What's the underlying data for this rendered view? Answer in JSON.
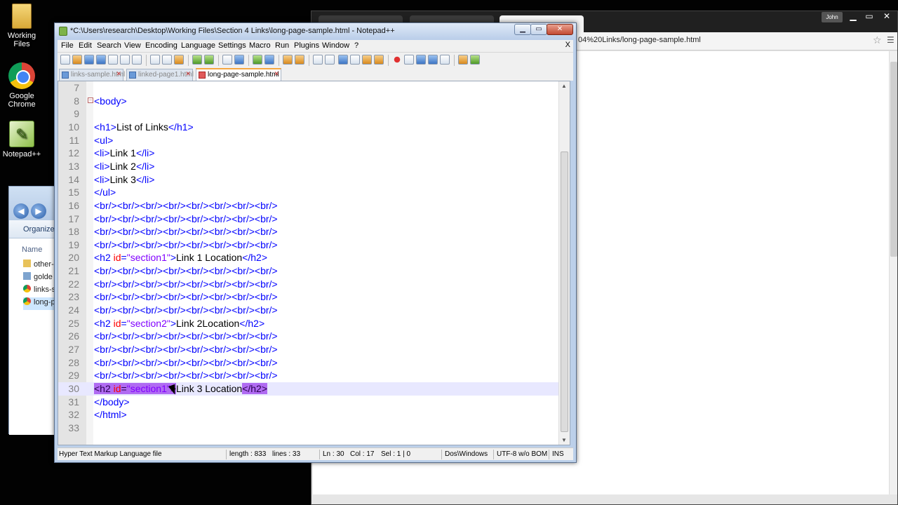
{
  "desktop": {
    "icons": [
      {
        "label": "Working Files",
        "icon": "folder-icon"
      },
      {
        "label": "Google Chrome",
        "icon": "chrome-icon"
      },
      {
        "label": "Notepad++",
        "icon": "notepadpp-icon"
      }
    ]
  },
  "browser": {
    "user": "John",
    "url": "04%20Links/long-page-sample.html",
    "close_label": "×"
  },
  "explorer": {
    "organize": "Organize",
    "column_name": "Name",
    "files": [
      "other-",
      "golde",
      "links-s",
      "long-p"
    ]
  },
  "npp": {
    "title": "*C:\\Users\\research\\Desktop\\Working Files\\Section 4 Links\\long-page-sample.html - Notepad++",
    "window_buttons": {
      "minimize": "▁",
      "maximize": "▭",
      "close": "✕"
    },
    "menu": [
      "File",
      "Edit",
      "Search",
      "View",
      "Encoding",
      "Language",
      "Settings",
      "Macro",
      "Run",
      "Plugins",
      "Window",
      "?"
    ],
    "menu_close": "X",
    "tabs": [
      {
        "label": "links-sample.html"
      },
      {
        "label": "linked-page1.html"
      },
      {
        "label": "long-page-sample.html"
      }
    ],
    "active_tab": 2,
    "current_line": 30,
    "lines": [
      {
        "n": "7",
        "code": ""
      },
      {
        "n": "8",
        "code": "<body>"
      },
      {
        "n": "9",
        "code": ""
      },
      {
        "n": "10",
        "code": "<h1>List of Links</h1>"
      },
      {
        "n": "11",
        "code": "<ul>"
      },
      {
        "n": "12",
        "code": "<li>Link 1</li>"
      },
      {
        "n": "13",
        "code": "<li>Link 2</li>"
      },
      {
        "n": "14",
        "code": "<li>Link 3</li>"
      },
      {
        "n": "15",
        "code": "</ul>"
      },
      {
        "n": "16",
        "code": "<br/><br/><br/><br/><br/><br/><br/><br/>"
      },
      {
        "n": "17",
        "code": "<br/><br/><br/><br/><br/><br/><br/><br/>"
      },
      {
        "n": "18",
        "code": "<br/><br/><br/><br/><br/><br/><br/><br/>"
      },
      {
        "n": "19",
        "code": "<br/><br/><br/><br/><br/><br/><br/><br/>"
      },
      {
        "n": "20",
        "code": "<h2 id=\"section1\">Link 1 Location</h2>"
      },
      {
        "n": "21",
        "code": "<br/><br/><br/><br/><br/><br/><br/><br/>"
      },
      {
        "n": "22",
        "code": "<br/><br/><br/><br/><br/><br/><br/><br/>"
      },
      {
        "n": "23",
        "code": "<br/><br/><br/><br/><br/><br/><br/><br/>"
      },
      {
        "n": "24",
        "code": "<br/><br/><br/><br/><br/><br/><br/><br/>"
      },
      {
        "n": "25",
        "code": "<h2 id=\"section2\">Link 2Location</h2>"
      },
      {
        "n": "26",
        "code": "<br/><br/><br/><br/><br/><br/><br/><br/>"
      },
      {
        "n": "27",
        "code": "<br/><br/><br/><br/><br/><br/><br/><br/>"
      },
      {
        "n": "28",
        "code": "<br/><br/><br/><br/><br/><br/><br/><br/>"
      },
      {
        "n": "29",
        "code": "<br/><br/><br/><br/><br/><br/><br/><br/>"
      },
      {
        "n": "30",
        "code": "<h2 id=\"section1\">Link 3 Location</h2>"
      },
      {
        "n": "31",
        "code": "</body>"
      },
      {
        "n": "32",
        "code": "</html>"
      },
      {
        "n": "33",
        "code": ""
      }
    ],
    "status": {
      "filetype": "Hyper Text Markup Language file",
      "length": "length : 833",
      "lines": "lines : 33",
      "ln": "Ln : 30",
      "col": "Col : 17",
      "sel": "Sel : 1 | 0",
      "eol": "Dos\\Windows",
      "encoding": "UTF-8 w/o BOM",
      "mode": "INS"
    }
  },
  "colors": {
    "tag": "#0000ff",
    "attribute": "#ff0000",
    "value": "#8000ff",
    "current_line": "#e8e8ff",
    "tag_match": "#b06bf2"
  }
}
